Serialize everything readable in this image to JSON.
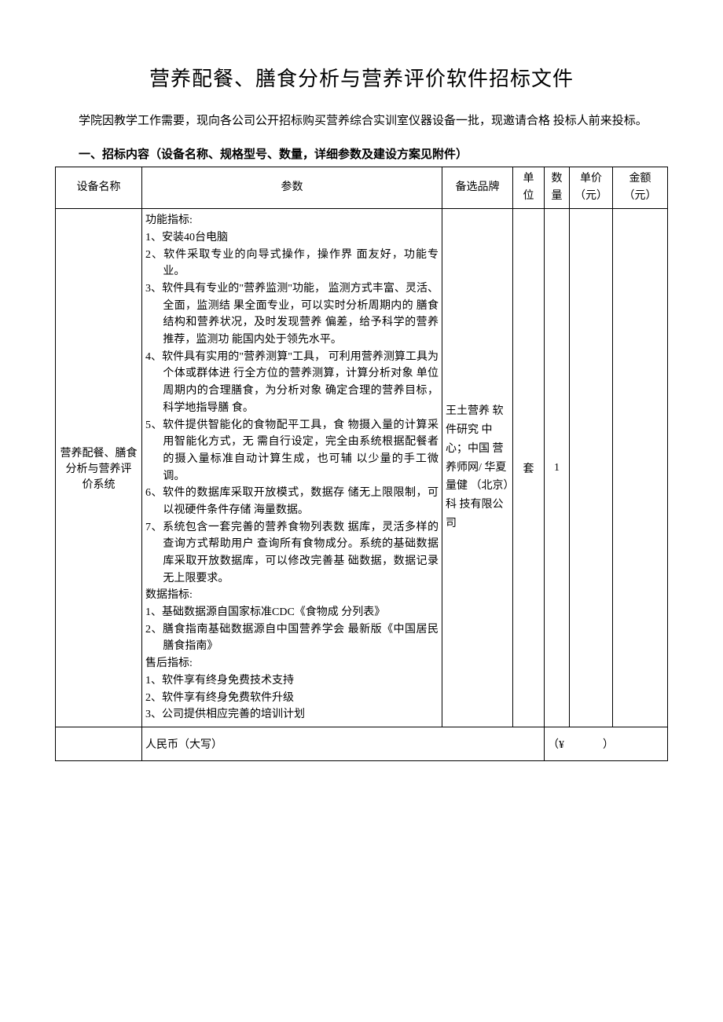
{
  "title": "营养配餐、膳食分析与营养评价软件招标文件",
  "intro": "学院因教学工作需要，现向各公司公开招标购买营养综合实训室仪器设备一批，现邀请合格 投标人前来投标。",
  "section_heading": "一、招标内容（设备名称、规格型号、数量，详细参数及建设方案见附件）",
  "headers": {
    "name": "设备名称",
    "params": "参数",
    "brand": "备选品牌",
    "unit": "单 位",
    "qty": "数 量",
    "price": "单价 （元）",
    "amount": "金额 （元）"
  },
  "row": {
    "name": "营养配餐、膳食分析与营养评 价系统",
    "params": {
      "func_label": "功能指标:",
      "func_items": [
        "1、安装40台电脑",
        "2、软件采取专业的向导式操作，操作界 面友好，功能专业。",
        "3、软件具有专业的\"营养监测\"功能， 监测方式丰富、灵活、全面，监测结 果全面专业，可以实时分析周期内的 膳食结构和营养状况，及时发现营养 偏差，给予科学的营养推荐，监测功 能国内处于领先水平。",
        "4、软件具有实用的\"营养测算\"工具， 可利用营养测算工具为个体或群体进 行全方位的营养测算，计算分析对象 单位周期内的合理膳食，为分析对象 确定合理的营养目标，科学地指导膳 食。",
        "5、软件提供智能化的食物配平工具，食 物摄入量的计算采用智能化方式，无 需自行设定，完全由系统根据配餐者 的摄入量标准自动计算生成，也可辅 以少量的手工微调。",
        "6、软件的数据库采取开放模式，数据存 储无上限限制，可以视硬件条件存储 海量数据。",
        "7、系统包含一套完善的营养食物列表数 据库，灵活多样的查询方式帮助用户 查询所有食物成分。系统的基础数据 库采取开放数据库，可以修改完善基 础数据，数据记录无上限要求。"
      ],
      "data_label": "数据指标:",
      "data_items": [
        "1、基础数据源自国家标准CDC《食物成 分列表》",
        "2、膳食指南基础数据源自中国营养学会 最新版《中国居民膳食指南》"
      ],
      "after_label": "售后指标:",
      "after_items": [
        "1、软件享有终身免费技术支持",
        "2、软件享有终身免费软件升级",
        "3、公司提供相应完善的培训计划"
      ]
    },
    "brand": "王土营养 软件研究 中心；中国 营养师网/ 华夏量健 （北京）科 技有限公司",
    "unit": "套",
    "qty": "1",
    "price": "",
    "amount": ""
  },
  "footer": {
    "rmb_label": "人民币（大写）",
    "yen_prefix": "（¥",
    "yen_suffix": "）"
  }
}
